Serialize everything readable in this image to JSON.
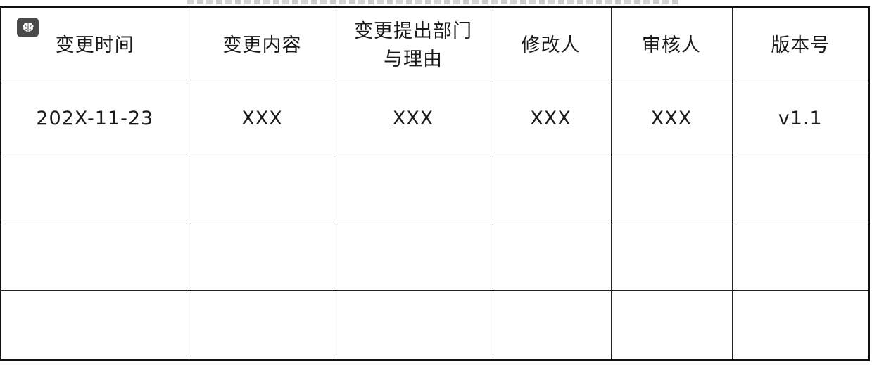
{
  "table": {
    "headers": [
      "变更时间",
      "变更内容",
      "变更提出部门与理由",
      "修改人",
      "审核人",
      "版本号"
    ],
    "rows": [
      [
        "202X-11-23",
        "XXX",
        "XXX",
        "XXX",
        "XXX",
        "v1.1"
      ],
      [
        "",
        "",
        "",
        "",
        "",
        ""
      ],
      [
        "",
        "",
        "",
        "",
        "",
        ""
      ],
      [
        "",
        "",
        "",
        "",
        "",
        ""
      ]
    ]
  },
  "badge": {
    "icon": "brain-icon",
    "color": "#4a4a4a"
  }
}
